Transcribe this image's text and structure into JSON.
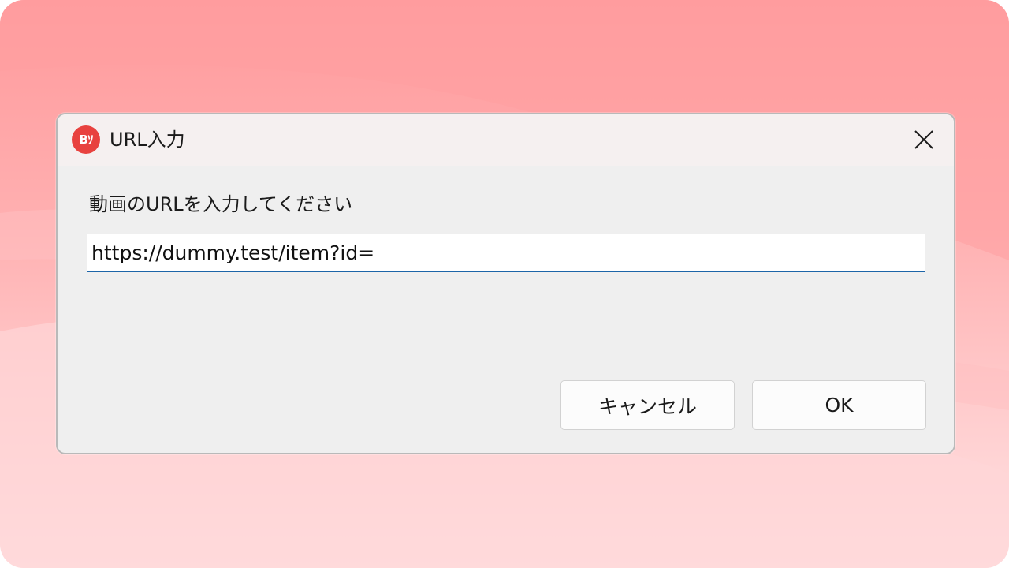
{
  "dialog": {
    "title": "URL入力",
    "app_icon_text": "Bｿ",
    "prompt": "動画のURLを入力してください",
    "url_value": "https://dummy.test/item?id=",
    "cancel_label": "キャンセル",
    "ok_label": "OK"
  },
  "icons": {
    "app": "app-logo-icon",
    "close": "close-icon"
  },
  "colors": {
    "accent": "#1d65a8",
    "app_icon": "#e8423f",
    "background": "#ffadae"
  }
}
